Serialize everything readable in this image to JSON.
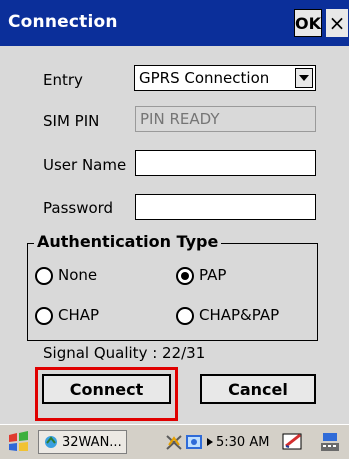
{
  "window": {
    "title": "Connection",
    "ok_label": "OK",
    "close_label": "×"
  },
  "form": {
    "entry_label": "Entry",
    "entry_value": "GPRS Connection",
    "sim_pin_label": "SIM PIN",
    "sim_pin_placeholder": "PIN READY",
    "username_label": "User Name",
    "username_value": "",
    "password_label": "Password",
    "password_value": ""
  },
  "auth": {
    "title": "Authentication Type",
    "options": [
      {
        "label": "None",
        "selected": false
      },
      {
        "label": "PAP",
        "selected": true
      },
      {
        "label": "CHAP",
        "selected": false
      },
      {
        "label": "CHAP&PAP",
        "selected": false
      }
    ]
  },
  "signal": {
    "text": "Signal Quality : 22/31"
  },
  "buttons": {
    "connect": "Connect",
    "cancel": "Cancel"
  },
  "taskbar": {
    "app_label": "32WAN...",
    "time": "5:30 AM",
    "icons": [
      "start-icon",
      "app-icon",
      "network-icon",
      "sync-icon",
      "arrow-icon",
      "pen-icon",
      "keyboard-icon"
    ]
  },
  "colors": {
    "titlebar": "#0b2f9a",
    "content_bg": "#d9d9d9",
    "highlight": "#e00000"
  }
}
